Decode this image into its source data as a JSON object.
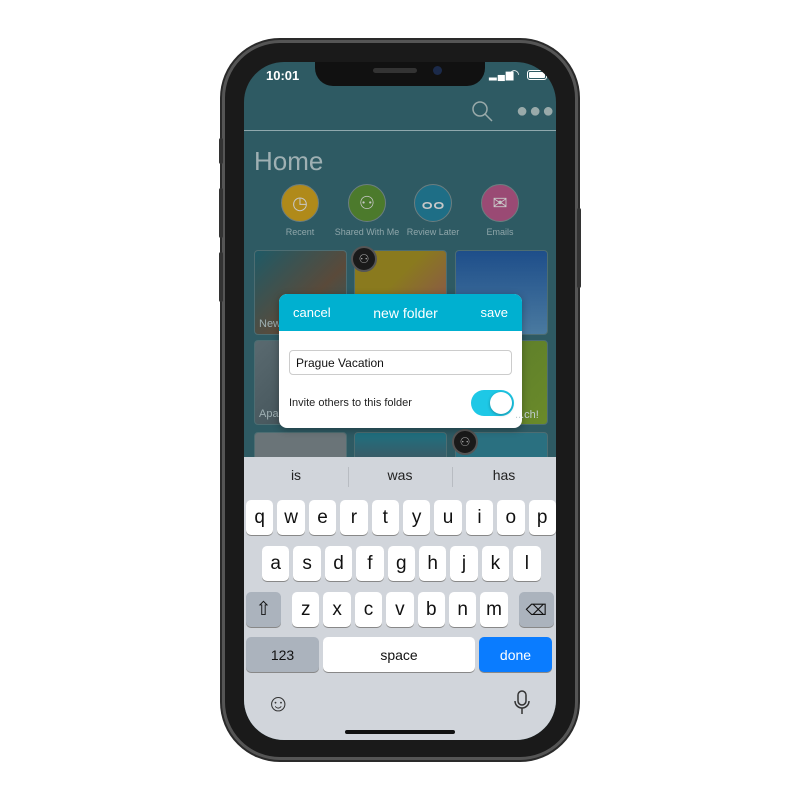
{
  "status_bar": {
    "time": "10:01"
  },
  "header": {
    "search_icon": "search-icon",
    "more_icon": "more-dots-icon"
  },
  "page_title": "Home",
  "categories": [
    {
      "label": "Recent",
      "icon": "clock-icon",
      "color": "#b08a1a"
    },
    {
      "label": "Shared With Me",
      "icon": "people-icon",
      "color": "#4c7a2c"
    },
    {
      "label": "Review Later",
      "icon": "glasses-icon",
      "color": "#1e6e86"
    },
    {
      "label": "Emails",
      "icon": "envelope-icon",
      "color": "#9a4a74"
    }
  ],
  "tiles": [
    {
      "label": "New"
    },
    {
      "label": ""
    },
    {
      "label": ""
    },
    {
      "label": "Apa... Hun..."
    },
    {
      "label": ""
    },
    {
      "label": "...ch!"
    },
    {
      "label": ""
    },
    {
      "label": ""
    },
    {
      "label": ""
    }
  ],
  "dialog": {
    "cancel": "cancel",
    "title": "new folder",
    "save": "save",
    "folder_name": "Prague Vacation",
    "invite_label": "Invite others to this folder",
    "invite_enabled": true,
    "accent": "#00b0d0"
  },
  "keyboard": {
    "suggestions": [
      "is",
      "was",
      "has"
    ],
    "row1": [
      "q",
      "w",
      "e",
      "r",
      "t",
      "y",
      "u",
      "i",
      "o",
      "p"
    ],
    "row2": [
      "a",
      "s",
      "d",
      "f",
      "g",
      "h",
      "j",
      "k",
      "l"
    ],
    "row3": [
      "z",
      "x",
      "c",
      "v",
      "b",
      "n",
      "m"
    ],
    "numbers": "123",
    "space": "space",
    "done": "done",
    "done_color": "#0a7cff"
  }
}
